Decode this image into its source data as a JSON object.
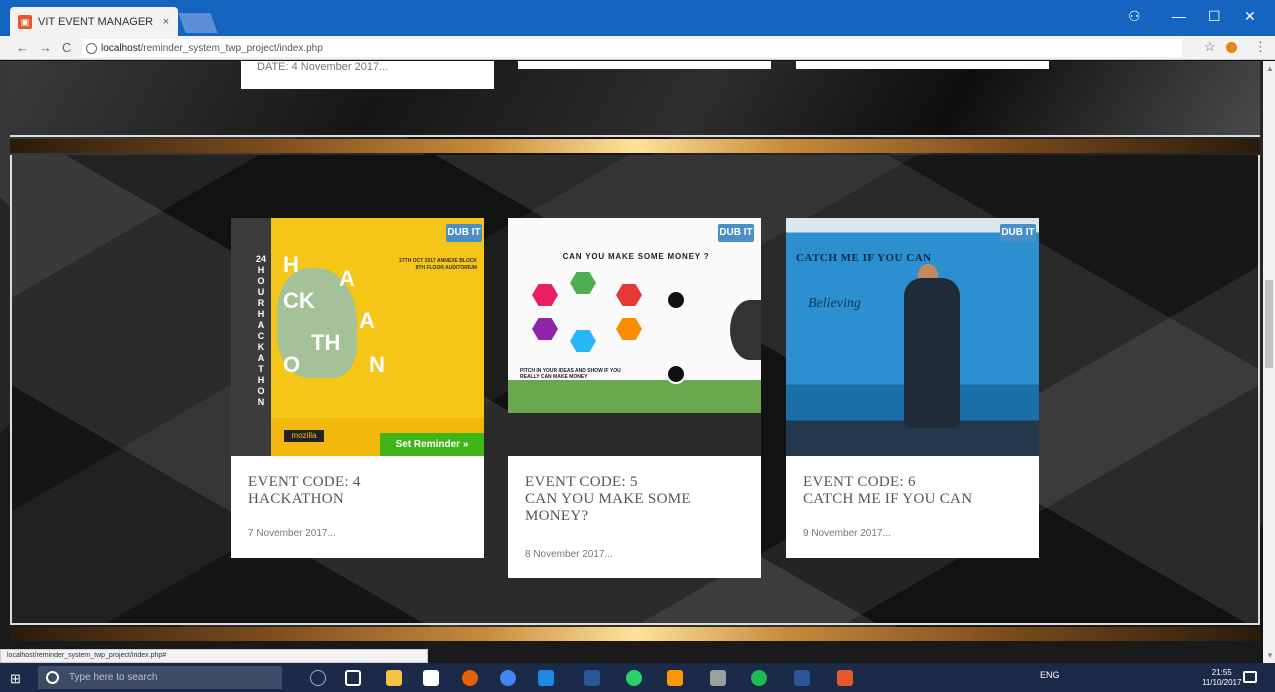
{
  "browser": {
    "tab_title": "VIT EVENT MANAGER",
    "tab_close": "×",
    "url_host": "localhost",
    "url_path": "/reminder_system_twp_project/index.php",
    "status_url": "localhost/reminder_system_twp_project/index.php#"
  },
  "window_controls": {
    "user": "⚇",
    "minimize": "—",
    "maximize": "☐",
    "close": "✕"
  },
  "nav": {
    "back": "←",
    "forward": "→",
    "reload": "C",
    "star": "☆",
    "menu": "⋮"
  },
  "top_cards": [
    {
      "date": "DATE: 4 November 2017..."
    }
  ],
  "events": [
    {
      "title_line1": "EVENT CODE: 4",
      "title_line2": "HACKATHON",
      "date": "7 November 2017...",
      "badge": "DUB IT",
      "reminder_label": "Set Reminder »",
      "poster": {
        "vertical_text": "24HOURHACKATHON",
        "letters": [
          "H",
          "A",
          "CK",
          "A",
          "TH",
          "O",
          "N"
        ],
        "info": "27TH OCT 2017 ANNEXE BLOCK 8TH FLOOR AUDITORIUM",
        "sponsor": "mozilla"
      }
    },
    {
      "title_line1": "EVENT CODE: 5",
      "title_line2": "CAN YOU MAKE SOME MONEY?",
      "date": "8 November 2017...",
      "badge": "DUB IT",
      "poster": {
        "heading": "CAN YOU MAKE SOME MONEY ?",
        "pitch": "PITCH IN YOUR IDEAS AND SHOW IF YOU REALLY CAN MAKE MONEY"
      }
    },
    {
      "title_line1": "EVENT CODE: 6",
      "title_line2": "CATCH ME IF YOU CAN",
      "date": "9 November 2017...",
      "badge": "DUB IT",
      "poster": {
        "heading": "CATCH ME IF YOU CAN",
        "script": "Believing"
      }
    }
  ],
  "taskbar": {
    "search_placeholder": "Type here to search",
    "tray_lang": "ENG",
    "clock_time": "21:55",
    "clock_date": "11/10/2017"
  },
  "colors": {
    "titlebar": "#1565c0",
    "reminder_button": "#3fb618",
    "taskbar": "#1c2a4a"
  }
}
